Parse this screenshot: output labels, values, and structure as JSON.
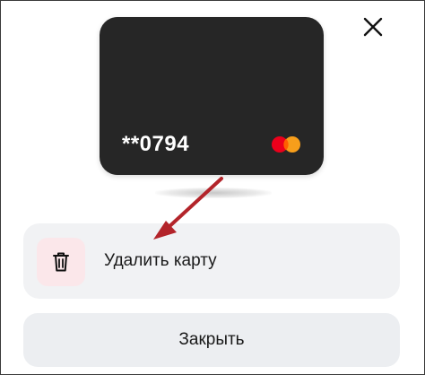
{
  "card": {
    "masked_number": "**0794",
    "brand_icon": "mastercard-logo",
    "background_color": "#262626"
  },
  "actions": {
    "delete_label": "Удалить карту",
    "delete_icon": "trash-icon",
    "close_label": "Закрыть"
  },
  "header": {
    "close_icon": "close-icon"
  },
  "annotation": {
    "arrow_color": "#b3242a"
  }
}
